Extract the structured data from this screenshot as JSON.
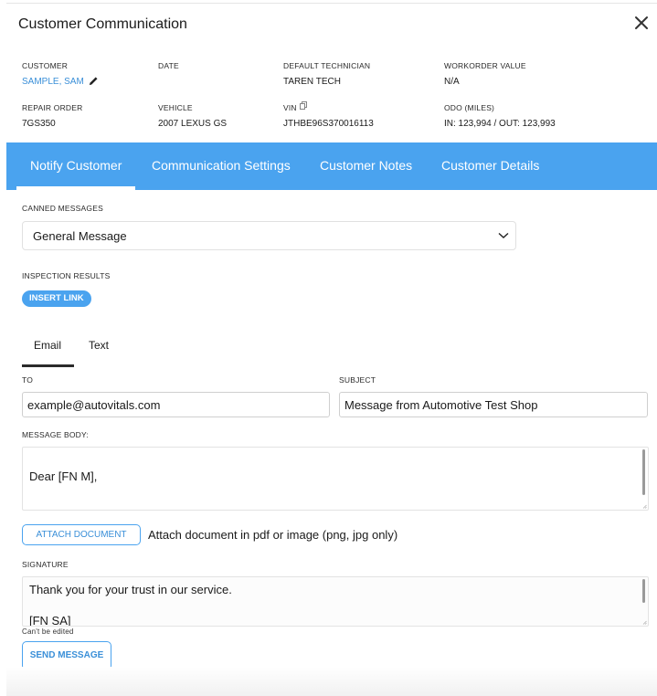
{
  "dialog": {
    "title": "Customer Communication"
  },
  "summary": {
    "customer_label": "CUSTOMER",
    "customer_value": "SAMPLE, SAM",
    "date_label": "DATE",
    "date_value": "",
    "technician_label": "DEFAULT TECHNICIAN",
    "technician_value": "TAREN TECH",
    "workorder_label": "WORKORDER VALUE",
    "workorder_value": "N/A",
    "repair_order_label": "REPAIR ORDER",
    "repair_order_value": "7GS350",
    "vehicle_label": "VEHICLE",
    "vehicle_value": "2007 LEXUS GS",
    "vin_label": "VIN",
    "vin_value": "JTHBE96S370016113",
    "odo_label": "ODO (MILES)",
    "odo_value": "IN: 123,994 / OUT: 123,993"
  },
  "tabs": [
    {
      "label": "Notify Customer",
      "active": true
    },
    {
      "label": "Communication Settings",
      "active": false
    },
    {
      "label": "Customer Notes",
      "active": false
    },
    {
      "label": "Customer Details",
      "active": false
    }
  ],
  "notify": {
    "canned_label": "CANNED MESSAGES",
    "canned_selected": "General Message",
    "inspection_label": "INSPECTION RESULTS",
    "insert_link_label": "INSERT LINK",
    "channels": [
      {
        "label": "Email",
        "active": true
      },
      {
        "label": "Text",
        "active": false
      }
    ],
    "to_label": "TO",
    "to_value": "example@autovitals.com",
    "subject_label": "SUBJECT",
    "subject_value": "Message from Automotive Test Shop",
    "body_label": "MESSAGE BODY:",
    "body_text": "Dear [FN M],",
    "attach_button": "ATTACH DOCUMENT",
    "attach_hint": "Attach document in pdf or image (png, jpg only)",
    "signature_label": "SIGNATURE",
    "signature_line1": "Thank you for your trust in our service.",
    "signature_line2": "[FN SA]",
    "signature_note": "Can't be edited",
    "send_button": "SEND MESSAGE"
  },
  "icons": {
    "close": "close-icon",
    "edit": "pencil-icon",
    "copy": "copy-icon",
    "dropdown": "chevron-down-icon"
  },
  "colors": {
    "accent": "#4aa3ef",
    "link": "#3a8fd8"
  }
}
